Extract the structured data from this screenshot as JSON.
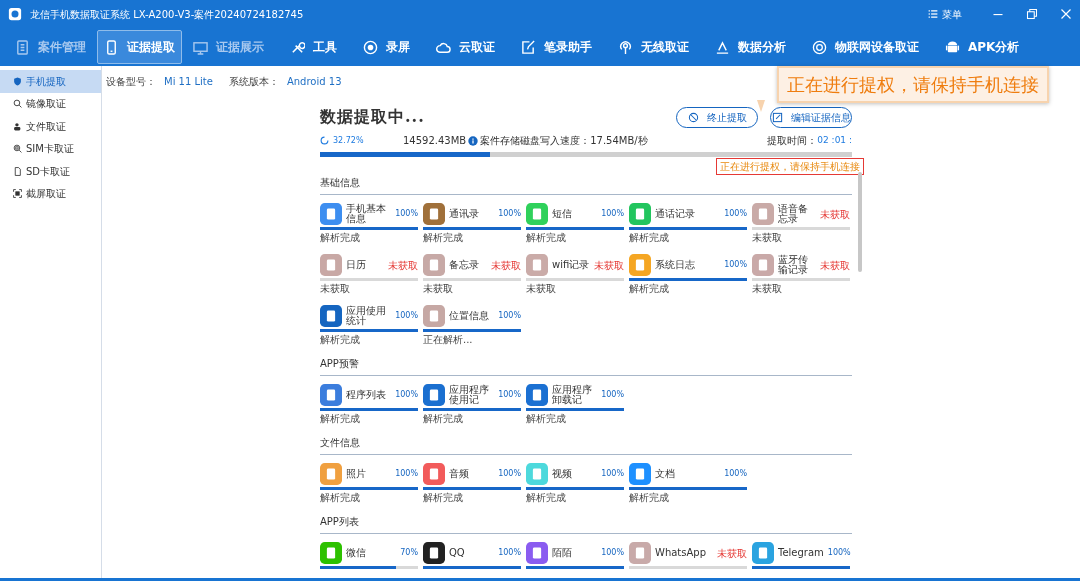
{
  "window": {
    "title": "龙信手机数据取证系统 LX-A200-V3-案件20240724182745",
    "menu": "菜单"
  },
  "nav": [
    {
      "label": "案件管理",
      "selected": false,
      "disabled": true
    },
    {
      "label": "证据提取",
      "selected": true,
      "disabled": false
    },
    {
      "label": "证据展示",
      "selected": false,
      "disabled": true
    },
    {
      "label": "工具",
      "selected": false,
      "disabled": false
    },
    {
      "label": "录屏",
      "selected": false,
      "disabled": false
    },
    {
      "label": "云取证",
      "selected": false,
      "disabled": false
    },
    {
      "label": "笔录助手",
      "selected": false,
      "disabled": false
    },
    {
      "label": "无线取证",
      "selected": false,
      "disabled": false
    },
    {
      "label": "数据分析",
      "selected": false,
      "disabled": false
    },
    {
      "label": "物联网设备取证",
      "selected": false,
      "disabled": false
    },
    {
      "label": "APK分析",
      "selected": false,
      "disabled": false
    }
  ],
  "sidebar": [
    {
      "label": "手机提取",
      "selected": true
    },
    {
      "label": "镜像取证",
      "selected": false
    },
    {
      "label": "文件取证",
      "selected": false
    },
    {
      "label": "SIM卡取证",
      "selected": false
    },
    {
      "label": "SD卡取证",
      "selected": false
    },
    {
      "label": "截屏取证",
      "selected": false
    }
  ],
  "device": {
    "model_label": "设备型号：",
    "model": "Mi 11 Lite",
    "os_label": "系统版本：",
    "os": "Android 13"
  },
  "extraction": {
    "title": "数据提取中...",
    "percent": "32.72%",
    "level": 0.32,
    "size": "14592.43MB",
    "speed": "案件存储磁盘写入速度：17.54MB/秒",
    "time_label": "提取时间：",
    "time": "02 :01 :",
    "notice": "正在进行提权，请保持手机连接"
  },
  "buttons": [
    "终止提取",
    "编辑证据信息"
  ],
  "callout": "正在进行提权，请保持手机连接",
  "sections": [
    {
      "title": "基础信息",
      "items": [
        {
          "name": "手机基本信息",
          "percent": "100%",
          "fetched": true,
          "level": 1,
          "status": "解析完成",
          "color": "#3d8ef0"
        },
        {
          "name": "通讯录",
          "percent": "100%",
          "fetched": true,
          "level": 1,
          "status": "解析完成",
          "color": "#a0703a"
        },
        {
          "name": "短信",
          "percent": "100%",
          "fetched": true,
          "level": 1,
          "status": "解析完成",
          "color": "#2fd15b"
        },
        {
          "name": "通话记录",
          "percent": "100%",
          "fetched": true,
          "level": 1,
          "status": "解析完成",
          "color": "#22c55e"
        },
        {
          "name": "语音备忘录",
          "percent": "未获取",
          "fetched": false,
          "level": 0,
          "status": "未获取",
          "color": "#c9aaa7"
        },
        {
          "name": "日历",
          "percent": "未获取",
          "fetched": false,
          "level": 0,
          "status": "未获取",
          "color": "#c8a8a5"
        },
        {
          "name": "备忘录",
          "percent": "未获取",
          "fetched": false,
          "level": 0,
          "status": "未获取",
          "color": "#c7a9a6"
        },
        {
          "name": "wifi记录",
          "percent": "未获取",
          "fetched": false,
          "level": 0,
          "status": "未获取",
          "color": "#caaba8"
        },
        {
          "name": "系统日志",
          "percent": "100%",
          "fetched": true,
          "level": 1,
          "status": "解析完成",
          "color": "#f5a623"
        },
        {
          "name": "蓝牙传输记录",
          "percent": "未获取",
          "fetched": false,
          "level": 0,
          "status": "未获取",
          "color": "#c9a9a8"
        },
        {
          "name": "应用使用统计",
          "percent": "100%",
          "fetched": true,
          "level": 1,
          "status": "解析完成",
          "color": "#1565c0"
        },
        {
          "name": "位置信息",
          "percent": "100%",
          "fetched": true,
          "level": 1,
          "status": "正在解析...",
          "color": "#c6a8a4"
        }
      ]
    },
    {
      "title": "APP预警",
      "items": [
        {
          "name": "程序列表",
          "percent": "100%",
          "fetched": true,
          "level": 1,
          "status": "解析完成",
          "color": "#3b7ddd"
        },
        {
          "name": "应用程序使用记",
          "percent": "100%",
          "fetched": true,
          "level": 1,
          "status": "解析完成",
          "color": "#1a6fd0"
        },
        {
          "name": "应用程序卸载记",
          "percent": "100%",
          "fetched": true,
          "level": 1,
          "status": "解析完成",
          "color": "#1b70d2"
        }
      ]
    },
    {
      "title": "文件信息",
      "items": [
        {
          "name": "照片",
          "percent": "100%",
          "fetched": true,
          "level": 1,
          "status": "解析完成",
          "color": "#f0a040"
        },
        {
          "name": "音频",
          "percent": "100%",
          "fetched": true,
          "level": 1,
          "status": "解析完成",
          "color": "#f25b5b"
        },
        {
          "name": "视频",
          "percent": "100%",
          "fetched": true,
          "level": 1,
          "status": "解析完成",
          "color": "#4dd9dc"
        },
        {
          "name": "文档",
          "percent": "100%",
          "fetched": true,
          "level": 1,
          "status": "解析完成",
          "color": "#1e90ff"
        }
      ]
    },
    {
      "title": "APP列表",
      "items": [
        {
          "name": "微信",
          "percent": "70%",
          "fetched": true,
          "level": 0.78,
          "color": "#2dc100"
        },
        {
          "name": "QQ",
          "percent": "100%",
          "fetched": true,
          "level": 1,
          "color": "#222222"
        },
        {
          "name": "陌陌",
          "percent": "100%",
          "fetched": true,
          "level": 1,
          "color": "#8a5cf0"
        },
        {
          "name": "WhatsApp",
          "percent": "未获取",
          "fetched": false,
          "level": 0,
          "color": "#c8aaa9"
        },
        {
          "name": "Telegram",
          "percent": "100%",
          "fetched": true,
          "level": 1,
          "color": "#2aa3e0"
        }
      ]
    }
  ]
}
